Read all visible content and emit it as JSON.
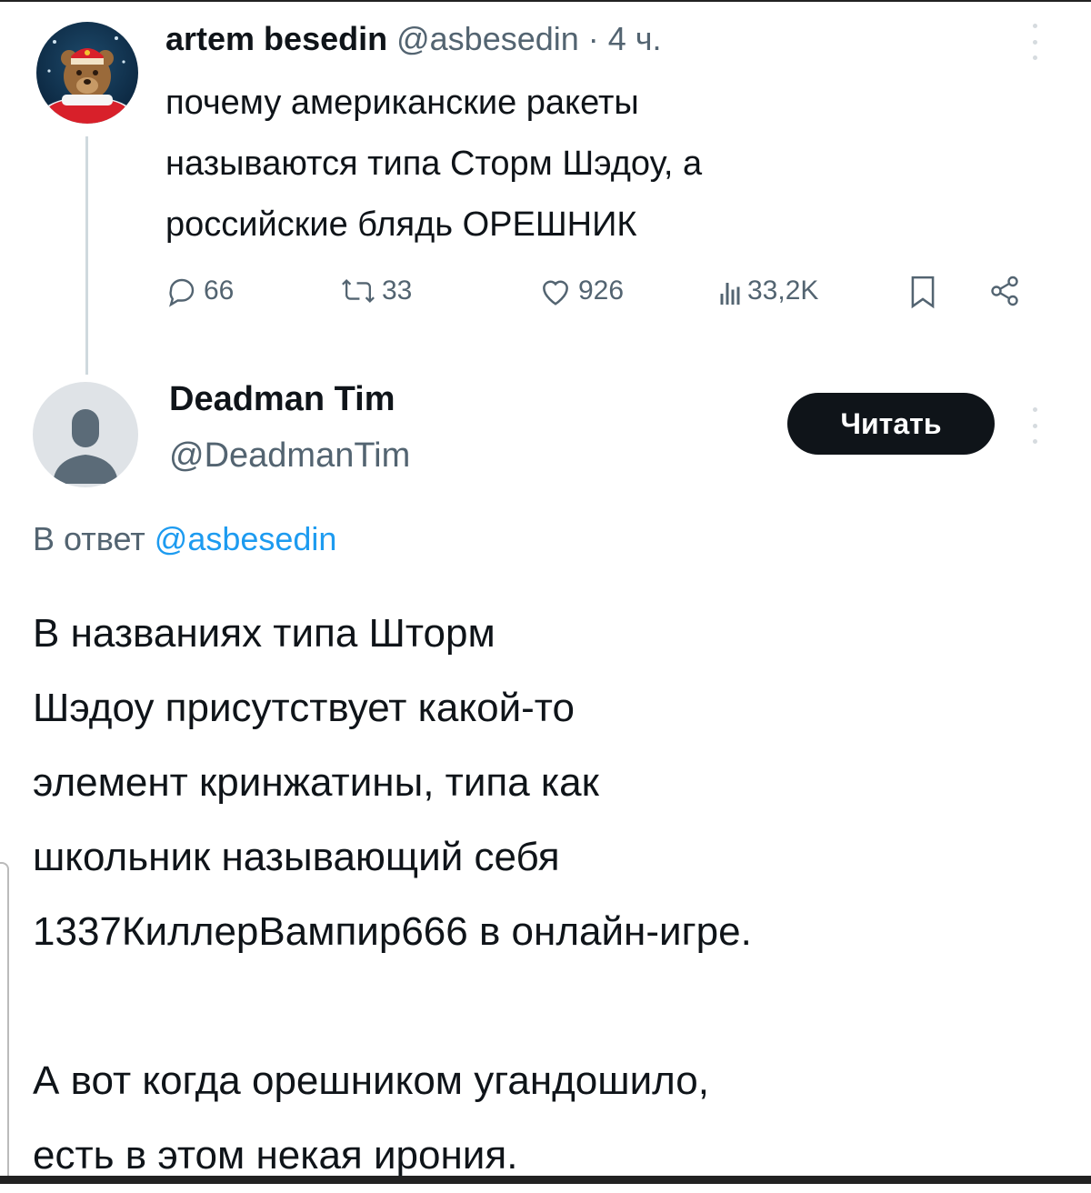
{
  "tweet": {
    "author_name": "artem besedin",
    "author_handle": "@asbesedin",
    "separator": " · ",
    "time": "4 ч.",
    "text_lines": [
      "почему американские ракеты",
      "называются типа Сторм Шэдоу, а",
      "российские блядь ОРЕШНИК"
    ],
    "stats": {
      "replies": "66",
      "reposts": "33",
      "likes": "926",
      "views": "33,2K"
    }
  },
  "reply": {
    "author_name": "Deadman Tim",
    "author_handle": "@DeadmanTim",
    "follow_label": "Читать",
    "reply_to_prefix": "В ответ ",
    "reply_to_handle": "@asbesedin",
    "paragraph1_lines": [
      "В названиях типа Шторм",
      "Шэдоу присутствует какой-то",
      "элемент кринжатины, типа как",
      "школьник называющий себя",
      "1337КиллерВампир666 в онлайн-игре."
    ],
    "paragraph2_lines": [
      "А вот когда орешником угандошило,",
      "есть в этом некая ирония."
    ]
  },
  "icons": [
    "more-icon",
    "reply-icon",
    "repost-icon",
    "like-icon",
    "views-icon",
    "bookmark-icon",
    "share-icon",
    "default-avatar-icon"
  ],
  "colors": {
    "text": "#0f1419",
    "secondary": "#536471",
    "link": "#1d9bf0",
    "button_bg": "#0f1419",
    "button_text": "#ffffff",
    "thread_line": "#cfd9de"
  }
}
